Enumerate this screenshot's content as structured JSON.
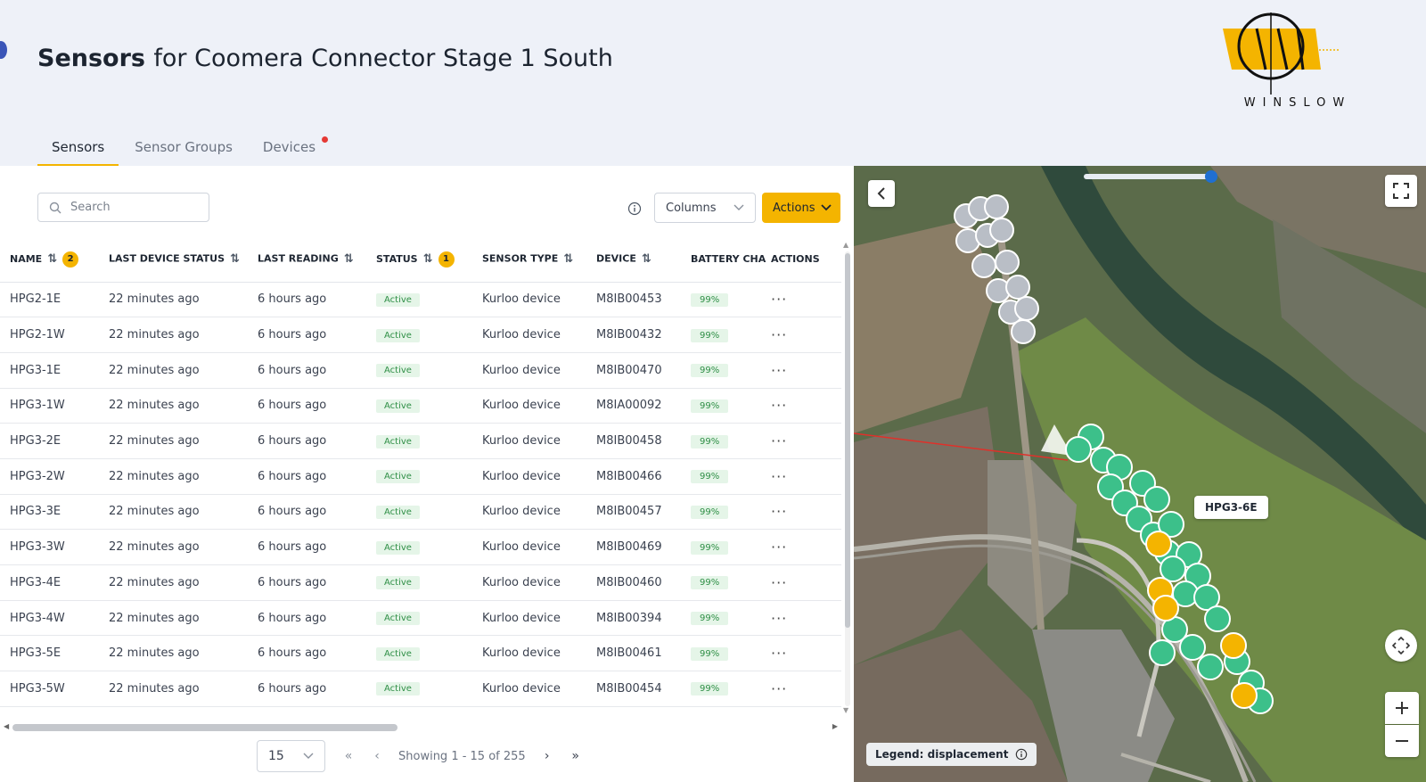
{
  "header": {
    "title_strong": "Sensors",
    "title_rest": "for Coomera Connector Stage 1 South",
    "logo_text": "WINSLOW"
  },
  "tabs": [
    {
      "label": "Sensors",
      "active": true
    },
    {
      "label": "Sensor Groups",
      "active": false
    },
    {
      "label": "Devices",
      "active": false,
      "notification": true
    }
  ],
  "toolbar": {
    "search_placeholder": "Search",
    "columns_label": "Columns",
    "actions_label": "Actions"
  },
  "table": {
    "columns": [
      {
        "label": "NAME",
        "sort": "sorted",
        "badge": "2"
      },
      {
        "label": "LAST DEVICE STATUS",
        "sort": "both"
      },
      {
        "label": "LAST READING",
        "sort": "both"
      },
      {
        "label": "STATUS",
        "sort": "sorted",
        "badge": "1"
      },
      {
        "label": "SENSOR TYPE",
        "sort": "both"
      },
      {
        "label": "DEVICE",
        "sort": "both"
      },
      {
        "label": "BATTERY CHA",
        "sort": "none"
      },
      {
        "label": "ACTIONS",
        "sort": "none"
      }
    ],
    "rows": [
      {
        "name": "HPG2-1E",
        "last_device_status": "22 minutes ago",
        "last_reading": "6 hours ago",
        "status": "Active",
        "sensor_type": "Kurloo device",
        "device": "M8IB00453",
        "battery": "99%"
      },
      {
        "name": "HPG2-1W",
        "last_device_status": "22 minutes ago",
        "last_reading": "6 hours ago",
        "status": "Active",
        "sensor_type": "Kurloo device",
        "device": "M8IB00432",
        "battery": "99%"
      },
      {
        "name": "HPG3-1E",
        "last_device_status": "22 minutes ago",
        "last_reading": "6 hours ago",
        "status": "Active",
        "sensor_type": "Kurloo device",
        "device": "M8IB00470",
        "battery": "99%"
      },
      {
        "name": "HPG3-1W",
        "last_device_status": "22 minutes ago",
        "last_reading": "6 hours ago",
        "status": "Active",
        "sensor_type": "Kurloo device",
        "device": "M8IA00092",
        "battery": "99%"
      },
      {
        "name": "HPG3-2E",
        "last_device_status": "22 minutes ago",
        "last_reading": "6 hours ago",
        "status": "Active",
        "sensor_type": "Kurloo device",
        "device": "M8IB00458",
        "battery": "99%"
      },
      {
        "name": "HPG3-2W",
        "last_device_status": "22 minutes ago",
        "last_reading": "6 hours ago",
        "status": "Active",
        "sensor_type": "Kurloo device",
        "device": "M8IB00466",
        "battery": "99%"
      },
      {
        "name": "HPG3-3E",
        "last_device_status": "22 minutes ago",
        "last_reading": "6 hours ago",
        "status": "Active",
        "sensor_type": "Kurloo device",
        "device": "M8IB00457",
        "battery": "99%"
      },
      {
        "name": "HPG3-3W",
        "last_device_status": "22 minutes ago",
        "last_reading": "6 hours ago",
        "status": "Active",
        "sensor_type": "Kurloo device",
        "device": "M8IB00469",
        "battery": "99%"
      },
      {
        "name": "HPG3-4E",
        "last_device_status": "22 minutes ago",
        "last_reading": "6 hours ago",
        "status": "Active",
        "sensor_type": "Kurloo device",
        "device": "M8IB00460",
        "battery": "99%"
      },
      {
        "name": "HPG3-4W",
        "last_device_status": "22 minutes ago",
        "last_reading": "6 hours ago",
        "status": "Active",
        "sensor_type": "Kurloo device",
        "device": "M8IB00394",
        "battery": "99%"
      },
      {
        "name": "HPG3-5E",
        "last_device_status": "22 minutes ago",
        "last_reading": "6 hours ago",
        "status": "Active",
        "sensor_type": "Kurloo device",
        "device": "M8IB00461",
        "battery": "99%"
      },
      {
        "name": "HPG3-5W",
        "last_device_status": "22 minutes ago",
        "last_reading": "6 hours ago",
        "status": "Active",
        "sensor_type": "Kurloo device",
        "device": "M8IB00454",
        "battery": "99%"
      }
    ],
    "row_action_icon": "more-horizontal-icon"
  },
  "pagination": {
    "page_size": "15",
    "summary": "Showing 1 - 15 of 255"
  },
  "map": {
    "tooltip": "HPG3-6E",
    "legend": "Legend: displacement",
    "slider_level": 0.93
  },
  "colors": {
    "accent": "#f4b400",
    "marker_ok": "#3cc08a",
    "marker_warn": "#f4b400",
    "marker_inactive": "#b9bec6",
    "active_badge_bg": "#e5f5e8",
    "active_badge_text": "#2f8f46",
    "slider_knob": "#1f6fd1"
  }
}
